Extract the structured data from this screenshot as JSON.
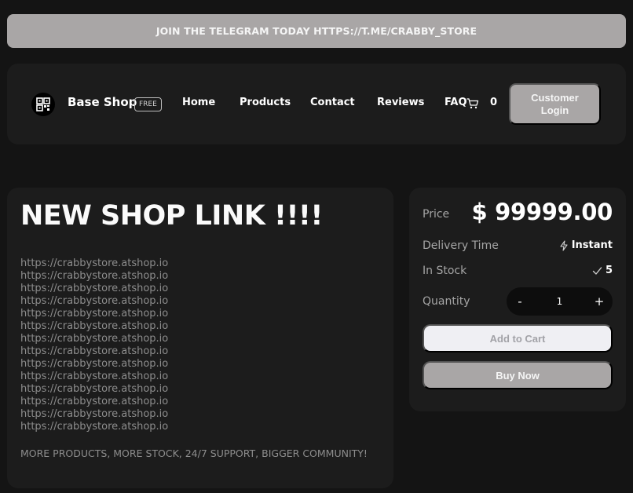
{
  "banner": {
    "text": "JOIN THE TELEGRAM TODAY HTTPS://T.ME/CRABBY_STORE"
  },
  "nav": {
    "brand": "Base Shop",
    "badge": "FREE",
    "links": [
      "Home",
      "Products",
      "Contact",
      "Reviews",
      "FAQ"
    ],
    "cart_count": "0",
    "login_label": "Customer Login"
  },
  "product": {
    "title": "NEW SHOP LINK !!!!",
    "links": [
      "https://crabbystore.atshop.io",
      "https://crabbystore.atshop.io",
      "https://crabbystore.atshop.io",
      "https://crabbystore.atshop.io",
      "https://crabbystore.atshop.io",
      "https://crabbystore.atshop.io",
      "https://crabbystore.atshop.io",
      "https://crabbystore.atshop.io",
      "https://crabbystore.atshop.io",
      "https://crabbystore.atshop.io",
      "https://crabbystore.atshop.io",
      "https://crabbystore.atshop.io",
      "https://crabbystore.atshop.io",
      "https://crabbystore.atshop.io"
    ],
    "promo": "MORE PRODUCTS, MORE STOCK, 24/7 SUPPORT, BIGGER COMMUNITY!"
  },
  "purchase": {
    "price_label": "Price",
    "price": "$ 99999.00",
    "delivery_label": "Delivery Time",
    "delivery_value": "Instant",
    "stock_label": "In Stock",
    "stock_value": "5",
    "quantity_label": "Quantity",
    "qty_minus": "-",
    "qty_plus": "+",
    "quantity": "1",
    "add_to_cart": "Add to Cart",
    "buy_now": "Buy Now"
  },
  "icons": {
    "logo": "qr-grid-icon",
    "cart": "cart-icon",
    "delivery": "lightning-icon",
    "stock": "checkmark-icon"
  },
  "colors": {
    "background": "#141414",
    "card": "#1c1c1c",
    "accent": "#a9a6a6",
    "add_to_cart_bg": "#efeff3"
  }
}
